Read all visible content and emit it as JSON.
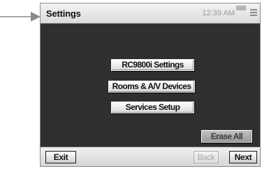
{
  "titlebar": {
    "title": "Settings",
    "clock": "12:39 AM",
    "battery_icon": "battery-icon",
    "menu_icon": "menu-icon"
  },
  "main": {
    "buttons": [
      {
        "label": "RC9800i Settings"
      },
      {
        "label": "Rooms & A/V Devices"
      },
      {
        "label": "Services Setup"
      },
      {
        "label": "Erase All"
      }
    ]
  },
  "bottombar": {
    "exit_label": "Exit",
    "back_label": "Back",
    "next_label": "Next"
  },
  "colors": {
    "content_background": "#2f2f2f",
    "bar_background": "#e4e4e4",
    "pointer_arrow": "#8a8a8a",
    "disabled_text": "#a8a8a8"
  }
}
